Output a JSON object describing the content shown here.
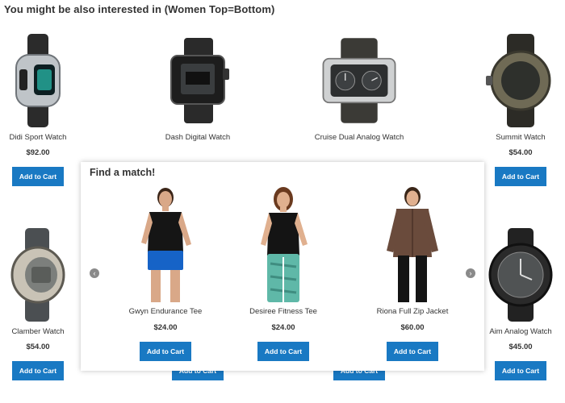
{
  "section_title": "You might be also interested in (Women Top=Bottom)",
  "products_top": [
    {
      "name": "Didi Sport Watch",
      "price": "$92.00",
      "cart_label": "Add to Cart",
      "icon": "sport-watch-image"
    },
    {
      "name": "Dash Digital Watch",
      "price": "",
      "cart_label": "",
      "icon": "digital-watch-image"
    },
    {
      "name": "Cruise Dual Analog Watch",
      "price": "",
      "cart_label": "",
      "icon": "dual-analog-watch-image"
    },
    {
      "name": "Summit Watch",
      "price": "$54.00",
      "cart_label": "Add to Cart",
      "icon": "summit-watch-image"
    }
  ],
  "products_bottom": [
    {
      "name": "Clamber Watch",
      "price": "$54.00",
      "cart_label": "Add to Cart",
      "icon": "clamber-watch-image"
    },
    {
      "name": "",
      "price": "",
      "cart_label": "Add to Cart",
      "icon": ""
    },
    {
      "name": "",
      "price": "",
      "cart_label": "Add to Cart",
      "icon": ""
    },
    {
      "name": "Aim Analog Watch",
      "price": "$45.00",
      "cart_label": "Add to Cart",
      "icon": "analog-watch-image"
    }
  ],
  "popup": {
    "title": "Find a match!",
    "prev_icon": "chevron-left-icon",
    "next_icon": "chevron-right-icon",
    "items": [
      {
        "name": "Gwyn Endurance Tee",
        "price": "$24.00",
        "cart_label": "Add to Cart"
      },
      {
        "name": "Desiree Fitness Tee",
        "price": "$24.00",
        "cart_label": "Add to Cart"
      },
      {
        "name": "Riona Full Zip Jacket",
        "price": "$60.00",
        "cart_label": "Add to Cart"
      }
    ]
  },
  "colors": {
    "accent": "#1979c3",
    "text": "#333333"
  }
}
